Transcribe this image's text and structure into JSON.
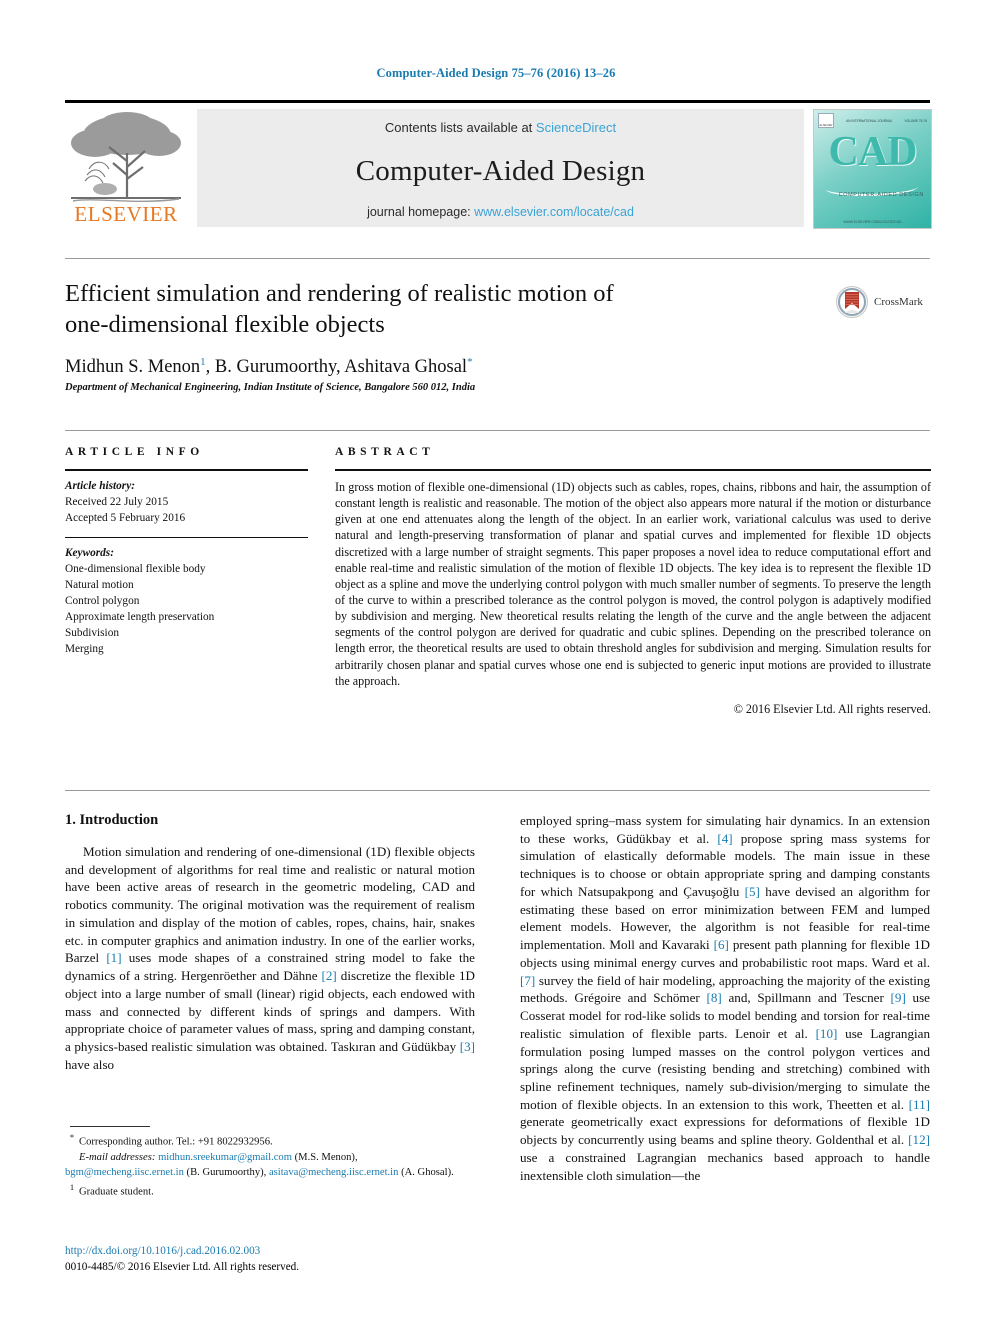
{
  "running_head": "Computer-Aided Design 75–76 (2016) 13–26",
  "masthead": {
    "contents_prefix": "Contents lists available at ",
    "sciencedirect": "ScienceDirect",
    "journal_name": "Computer-Aided Design",
    "homepage_prefix": "journal homepage: ",
    "homepage_url": "www.elsevier.com/locate/cad",
    "publisher_wordmark": "ELSEVIER",
    "cover": {
      "title": "CAD",
      "subtitle": "COMPUTER-AIDED DESIGN",
      "top_left_brand": "ELSEVIER",
      "top_center": "AN INTERNATIONAL JOURNAL",
      "top_right": "VOLUME 75-76",
      "footer": "WWW.ELSEVIER.COM/LOCATE/CAD"
    },
    "accent_blue": "#3aa3d6",
    "elsevier_orange": "#E87722",
    "cover_teal": "#2fb3a5"
  },
  "crossmark": {
    "label": "CrossMark"
  },
  "title": {
    "line1": "Efficient simulation and rendering of realistic motion of",
    "line2": "one-dimensional flexible objects"
  },
  "authors": {
    "a1_name": "Midhun S. Menon",
    "a1_sup": "1",
    "sep1": ", ",
    "a2_name": "B. Gurumoorthy",
    "sep2": ", ",
    "a3_name": "Ashitava Ghosal",
    "a3_sup": "*",
    "affiliation": "Department of Mechanical Engineering, Indian Institute of Science, Bangalore 560 012, India"
  },
  "article_info": {
    "heading": "ARTICLE INFO",
    "history_label": "Article history:",
    "received": "Received 22 July 2015",
    "accepted": "Accepted 5 February 2016",
    "keywords_label": "Keywords:",
    "keywords": [
      "One-dimensional flexible body",
      "Natural motion",
      "Control polygon",
      "Approximate length preservation",
      "Subdivision",
      "Merging"
    ]
  },
  "abstract": {
    "heading": "ABSTRACT",
    "text": "In gross motion of flexible one-dimensional (1D) objects such as cables, ropes, chains, ribbons and hair, the assumption of constant length is realistic and reasonable. The motion of the object also appears more natural if the motion or disturbance given at one end attenuates along the length of the object. In an earlier work, variational calculus was used to derive natural and length-preserving transformation of planar and spatial curves and implemented for flexible 1D objects discretized with a large number of straight segments. This paper proposes a novel idea to reduce computational effort and enable real-time and realistic simulation of the motion of flexible 1D objects. The key idea is to represent the flexible 1D object as a spline and move the underlying control polygon with much smaller number of segments. To preserve the length of the curve to within a prescribed tolerance as the control polygon is moved, the control polygon is adaptively modified by subdivision and merging. New theoretical results relating the length of the curve and the angle between the adjacent segments of the control polygon are derived for quadratic and cubic splines. Depending on the prescribed tolerance on length error, the theoretical results are used to obtain threshold angles for subdivision and merging. Simulation results for arbitrarily chosen planar and spatial curves whose one end is subjected to generic input motions are provided to illustrate the approach.",
    "copyright": "© 2016 Elsevier Ltd. All rights reserved."
  },
  "body": {
    "section_number_title": "1. Introduction",
    "left_paragraph_part1": "Motion simulation and rendering of one-dimensional (1D) flexible objects and development of algorithms for real time and realistic or natural motion have been active areas of research in the geometric modeling, CAD and robotics community. The original motivation was the requirement of realism in simulation and display of the motion of cables, ropes, chains, hair, snakes etc. in computer graphics and animation industry. In one of the earlier works, Barzel ",
    "ref1": "[1]",
    "left_paragraph_part2": " uses mode shapes of a constrained string model to fake the dynamics of a string. Hergenröether and Dähne ",
    "ref2": "[2]",
    "left_paragraph_part3": " discretize the flexible 1D object into a large number of small (linear) rigid objects, each endowed with mass and connected by different kinds of springs and dampers. With appropriate choice of parameter values of mass, spring and damping constant, a physics-based realistic simulation was obtained. Taskıran and Güdükbay ",
    "ref3": "[3]",
    "left_paragraph_part4": " have also",
    "right_paragraph_part1": "employed spring–mass system for simulating hair dynamics. In an extension to these works, Güdükbay et al. ",
    "ref4": "[4]",
    "right_paragraph_part2": " propose spring mass systems for simulation of elastically deformable models. The main issue in these techniques is to choose or obtain appropriate spring and damping constants for which Natsupakpong and Çavuşoğlu ",
    "ref5": "[5]",
    "right_paragraph_part3": " have devised an algorithm for estimating these based on error minimization between FEM and lumped element models. However, the algorithm is not feasible for real-time implementation. Moll and Kavaraki ",
    "ref6": "[6]",
    "right_paragraph_part4": " present path planning for flexible 1D objects using minimal energy curves and probabilistic root maps. Ward et al. ",
    "ref7": "[7]",
    "right_paragraph_part5": " survey the field of hair modeling, approaching the majority of the existing methods. Grégoire and Schömer ",
    "ref8": "[8]",
    "right_paragraph_part6": " and, Spillmann and Tescner ",
    "ref9": "[9]",
    "right_paragraph_part7": " use Cosserat model for rod-like solids to model bending and torsion for real-time realistic simulation of flexible parts. Lenoir et al. ",
    "ref10": "[10]",
    "right_paragraph_part8": " use Lagrangian formulation posing lumped masses on the control polygon vertices and springs along the curve (resisting bending and stretching) combined with spline refinement techniques, namely sub-division/merging to simulate the motion of flexible objects. In an extension to this work, Theetten et al. ",
    "ref11": "[11]",
    "right_paragraph_part9": " generate geometrically exact expressions for deformations of flexible 1D objects by concurrently using beams and spline theory. Goldenthal et al. ",
    "ref12": "[12]",
    "right_paragraph_part10": " use a constrained Lagrangian mechanics based approach to handle inextensible cloth simulation—the"
  },
  "footnotes": {
    "star_mark": "*",
    "corresponding": "Corresponding author. Tel.: +91 8022932956.",
    "email_label": "E-mail addresses:",
    "email1": "midhun.sreekumar@gmail.com",
    "email1_owner": " (M.S. Menon), ",
    "email2": "bgm@mecheng.iisc.ernet.in",
    "email2_owner": " (B. Gurumoorthy), ",
    "email3": "asitava@mecheng.iisc.ernet.in",
    "email3_owner": " (A. Ghosal).",
    "one_mark": "1",
    "graduate": "Graduate student."
  },
  "doi_block": {
    "doi": "http://dx.doi.org/10.1016/j.cad.2016.02.003",
    "issn_line": "0010-4485/© 2016 Elsevier Ltd. All rights reserved."
  }
}
